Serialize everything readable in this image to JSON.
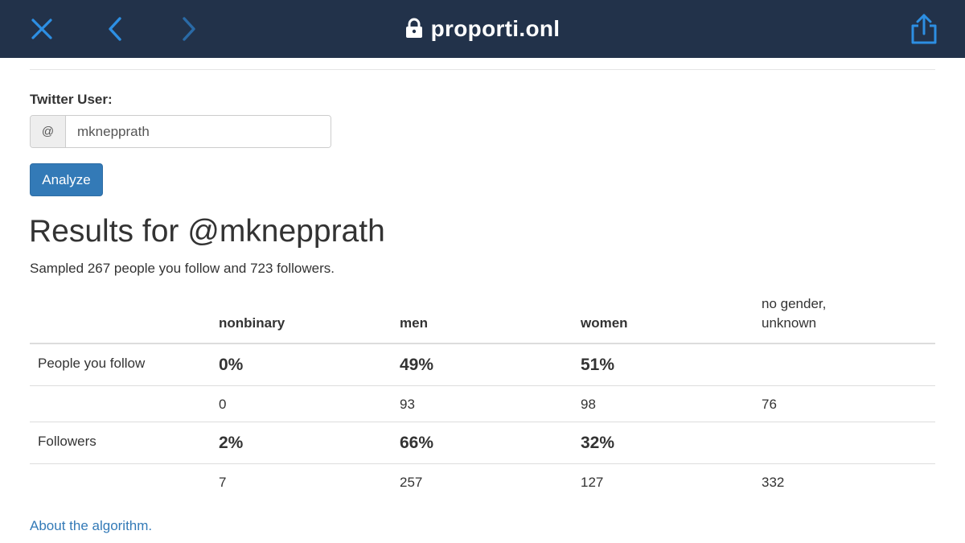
{
  "browser": {
    "url": "proporti.onl",
    "icons": {
      "close": "close-icon",
      "back": "chevron-left-icon",
      "forward": "chevron-right-icon",
      "lock": "lock-icon",
      "share": "share-icon"
    },
    "colors": {
      "bar_bg": "#22324a",
      "icon_active": "#2d8fe3",
      "icon_disabled": "#2a6aa6"
    }
  },
  "form": {
    "label": "Twitter User:",
    "prefix": "@",
    "username": "mknepprath",
    "analyze_label": "Analyze"
  },
  "results": {
    "title": "Results for @mknepprath",
    "sample": "Sampled 267 people you follow and 723 followers.",
    "columns": [
      "nonbinary",
      "men",
      "women",
      "no gender, unknown"
    ],
    "unknown_line1": "no gender,",
    "unknown_line2": "unknown",
    "rows": [
      {
        "label": "People you follow",
        "percents": [
          "0%",
          "49%",
          "51%"
        ],
        "counts": [
          "0",
          "93",
          "98",
          "76"
        ]
      },
      {
        "label": "Followers",
        "percents": [
          "2%",
          "66%",
          "32%"
        ],
        "counts": [
          "7",
          "257",
          "127",
          "332"
        ]
      }
    ]
  },
  "footer": {
    "about_link": "About the algorithm."
  },
  "colors": {
    "primary": "#337ab7",
    "text": "#333333",
    "border": "#dddddd"
  }
}
